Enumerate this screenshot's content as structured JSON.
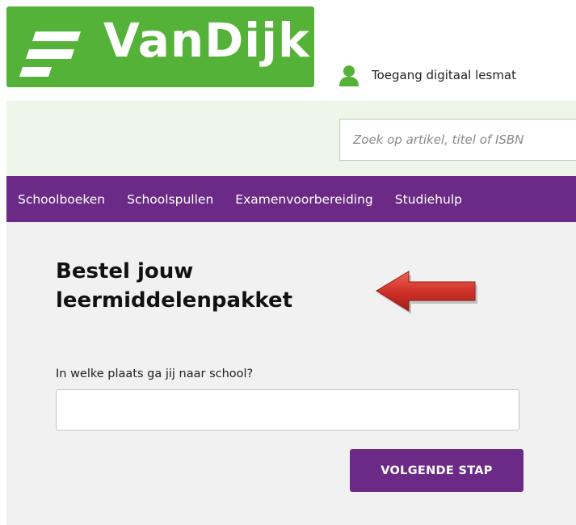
{
  "header": {
    "brand": "VanDijk",
    "account_link": "Toegang digitaal lesmat"
  },
  "search": {
    "placeholder": "Zoek op artikel, titel of ISBN"
  },
  "nav": {
    "items": [
      "Schoolboeken",
      "Schoolspullen",
      "Examenvoorbereiding",
      "Studiehulp"
    ]
  },
  "main": {
    "heading_line1": "Bestel jouw",
    "heading_line2": "leermiddelenpakket",
    "city_label": "In welke plaats ga jij naar school?",
    "city_value": "",
    "next_button": "VOLGENDE STAP"
  },
  "colors": {
    "brand_green": "#55b239",
    "nav_purple": "#6b2a86",
    "search_band": "#eef6e9",
    "arrow_red": "#c62a22"
  },
  "icons": {
    "logo_mark": "three-stacked-bars-icon",
    "account": "user-icon",
    "annotation": "left-arrow-icon"
  }
}
